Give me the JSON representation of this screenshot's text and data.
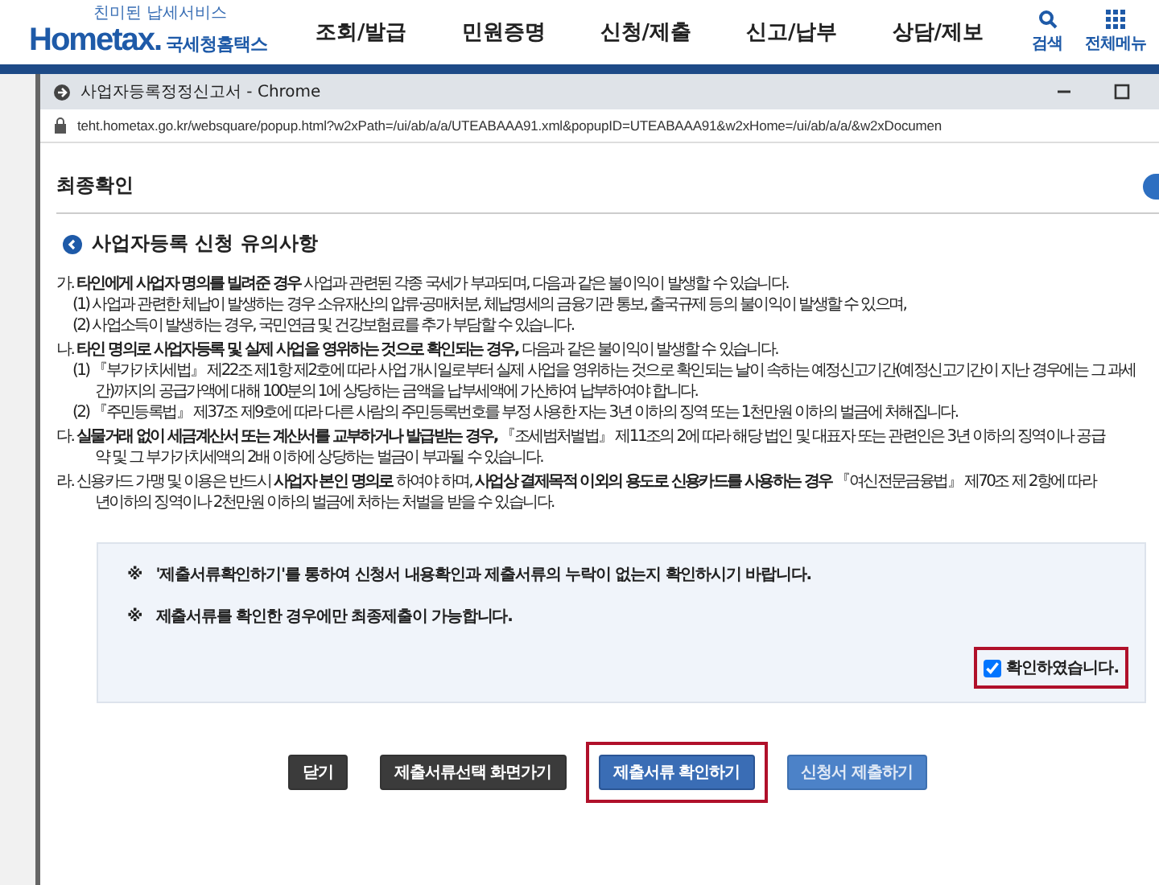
{
  "site_header": {
    "logo_tagline": "친미된 납세서비스",
    "logo_text": "Hometax.",
    "logo_subtitle": "국세청홈택스",
    "nav": [
      {
        "label": "조회/발급"
      },
      {
        "label": "민원증명"
      },
      {
        "label": "신청/제출"
      },
      {
        "label": "신고/납부"
      },
      {
        "label": "상담/제보"
      }
    ],
    "tools": [
      {
        "kind": "search",
        "label": "검색"
      },
      {
        "kind": "grid",
        "label": "전체메뉴"
      }
    ]
  },
  "popup": {
    "title": "사업자등록정정신고서 - Chrome",
    "url": "teht.hometax.go.kr/websquare/popup.html?w2xPath=/ui/ab/a/a/UTEABAAA91.xml&popupID=UTEABAAA91&w2xHome=/ui/ab/a/a/&w2xDocumen"
  },
  "page_title": "최종확인",
  "notice": {
    "heading": "사업자등록 신청 유의사항",
    "lines": [
      {
        "kind": "item",
        "text": "가. **타인에게 사업자 명의를 빌려준 경우** 사업과 관련된 각종 국세가 부과되며, 다음과 같은 불이익이 발생할 수 있습니다."
      },
      {
        "kind": "sub",
        "text": "(1) 사업과 관련한 체납이 발생하는 경우 소유재산의 압류·공매처분, 체납명세의 금융기관 통보, 출국규제 등의 불이익이 발생할 수 있으며,"
      },
      {
        "kind": "sub",
        "text": "(2) 사업소득이 발생하는 경우, 국민연금 및 건강보험료를 추가 부담할 수 있습니다."
      },
      {
        "kind": "item",
        "text": "나. **타인 명의로 사업자등록 및 실제 사업을 영위하는 것으로 확인되는 경우,** 다음과 같은 불이익이 발생할 수 있습니다."
      },
      {
        "kind": "sub",
        "text": "(1) 『부가가치세법』 제22조 제1항 제2호에 따라 사업 개시일로부터 실제 사업을 영위하는 것으로 확인되는 날이 속하는 예정신고기간(예정신고기간이 지난 경우에는 그 과세"
      },
      {
        "kind": "cont",
        "text": "간)까지의 공급가액에 대해 100분의 1에 상당하는 금액을 납부세액에 가산하여 납부하여야 합니다."
      },
      {
        "kind": "sub",
        "text": "(2) 『주민등록법』 제37조 제9호에 따라 다른 사람의 주민등록번호를 부정 사용한 자는 3년 이하의 징역 또는 1천만원 이하의 벌금에 처해집니다."
      },
      {
        "kind": "item",
        "text": "다. **실물거래 없이 세금계산서 또는 계산서를 교부하거나 발급받는 경우,** 『조세범처벌법』 제11조의 2에 따라 해당 법인 및 대표자 또는 관련인은 3년 이하의 징역이나 공급"
      },
      {
        "kind": "cont",
        "text": "약 및 그 부가가치세액의 2배 이하에 상당하는 벌금이 부과될 수 있습니다."
      },
      {
        "kind": "item",
        "text": "라. 신용카드 가맹 및 이용은 반드시 **사업자 본인 명의로** 하여야 하며, **사업상 결제목적 이외의 용도로 신용카드를 사용하는 경우** 『여신전문금융법』 제70조 제 2항에 따라"
      },
      {
        "kind": "cont",
        "text": "년이하의 징역이나 2천만원 이하의 벌금에 처하는 처벌을 받을 수 있습니다."
      }
    ]
  },
  "confirm_box": {
    "notes": [
      {
        "mark": "※",
        "text": "'제출서류확인하기'를 통하여 신청서 내용확인과 제출서류의 누락이 없는지 확인하시기 바랍니다."
      },
      {
        "mark": "※",
        "text": "제출서류를 확인한 경우에만 최종제출이 가능합니다."
      }
    ],
    "checkbox": {
      "label": "확인하였습니다.",
      "checked": true,
      "highlighted": true
    }
  },
  "buttons": [
    {
      "label": "닫기",
      "kind": "dark",
      "highlighted": false
    },
    {
      "label": "제출서류선택 화면가기",
      "kind": "dark",
      "highlighted": false
    },
    {
      "label": "제출서류 확인하기",
      "kind": "primary",
      "highlighted": true
    },
    {
      "label": "신청서 제출하기",
      "kind": "muted",
      "highlighted": false
    }
  ]
}
